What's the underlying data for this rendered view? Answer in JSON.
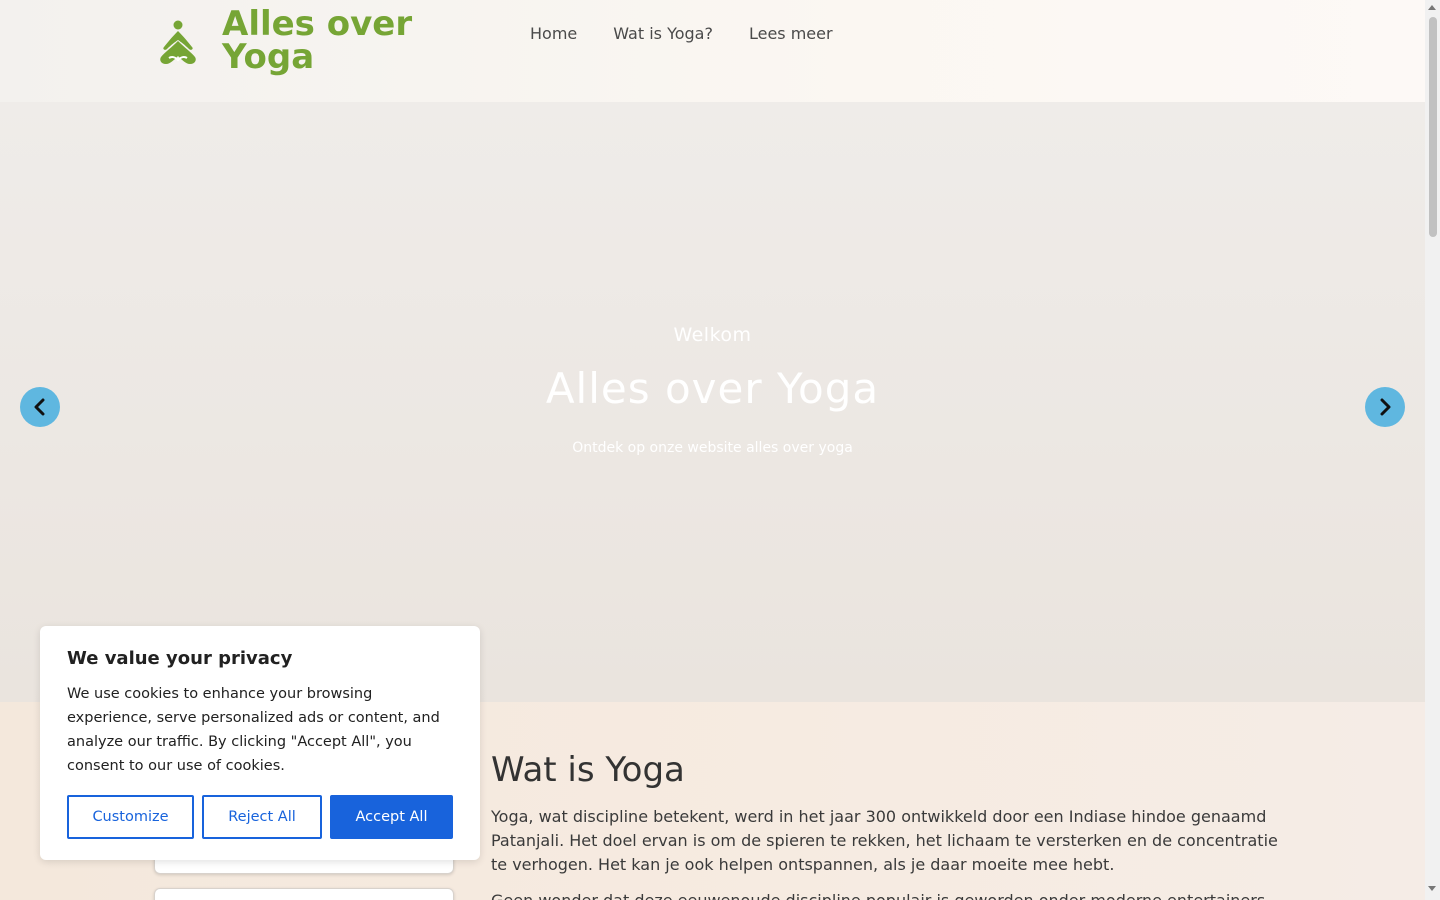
{
  "header": {
    "site_title": "Alles over Yoga",
    "logo_icon": "yoga-lotus-icon",
    "brand_color": "#76a535",
    "nav": [
      {
        "label": "Home"
      },
      {
        "label": "Wat is Yoga?"
      },
      {
        "label": "Lees meer"
      }
    ]
  },
  "hero": {
    "eyebrow": "Welkom",
    "title": "Alles over Yoga",
    "subtitle": "Ontdek op onze website alles over yoga",
    "prev_icon": "chevron-left-icon",
    "next_icon": "chevron-right-icon",
    "arrow_color": "#5fb7e0"
  },
  "content": {
    "heading": "Wat is Yoga",
    "paragraph_1": "Yoga, wat discipline betekent, werd in het jaar 300 ontwikkeld door een Indiase hindoe genaamd Patanjali. Het doel ervan is om de spieren te rekken, het lichaam te versterken en de concentratie te verhogen. Het kan je ook helpen ontspannen, als je daar moeite mee hebt.",
    "paragraph_2": "Geen wonder dat deze eeuwenoude discipline populair is geworden onder moderne entertainers."
  },
  "cookie": {
    "title": "We value your privacy",
    "text": "We use cookies to enhance your browsing experience, serve personalized ads or content, and analyze our traffic. By clicking \"Accept All\", you consent to our use of cookies.",
    "customize_label": "Customize",
    "reject_label": "Reject All",
    "accept_label": "Accept All",
    "accent_color": "#1863dc"
  }
}
